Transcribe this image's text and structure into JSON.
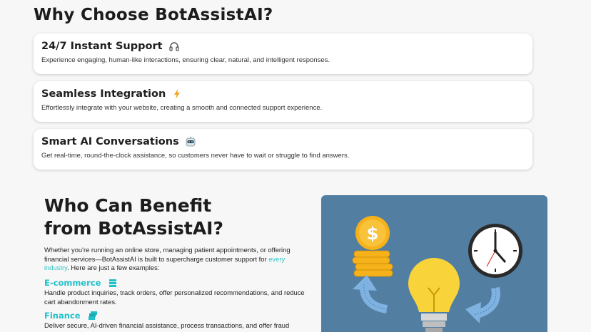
{
  "why": {
    "title": "Why Choose BotAssistAI?",
    "cards": [
      {
        "title": "24/7 Instant Support",
        "icon": "headphones-icon",
        "desc": "Experience engaging, human-like interactions, ensuring clear, natural, and intelligent responses."
      },
      {
        "title": "Seamless Integration",
        "icon": "lightning-icon",
        "desc": "Effortlessly integrate with your website, creating a smooth and connected support experience."
      },
      {
        "title": "Smart AI Conversations",
        "icon": "robot-icon",
        "desc": "Get real-time, round-the-clock assistance, so customers never have to wait or struggle to find answers."
      }
    ]
  },
  "benefit": {
    "title_line1": "Who Can Benefit",
    "title_line2": "from BotAssistAI?",
    "intro_pre": "Whether you're running an online store, managing patient appointments, or offering financial services—BotAssistAI is built to supercharge customer support for ",
    "intro_link": "every industry",
    "intro_post": ". Here are just a few examples:",
    "segments": [
      {
        "title": "E-commerce",
        "icon": "shopping-cart-icon",
        "desc": "Handle product inquiries, track orders, offer personalized recommendations, and reduce cart abandonment rates."
      },
      {
        "title": "Finance",
        "icon": "money-stack-icon",
        "desc": "Deliver secure, AI-driven financial assistance, process transactions, and offer fraud detection"
      }
    ]
  },
  "colors": {
    "accent": "#20c0c8",
    "illustration_bg": "#527ea2",
    "coin": "#f6b21a",
    "bulb": "#f8d43a"
  }
}
